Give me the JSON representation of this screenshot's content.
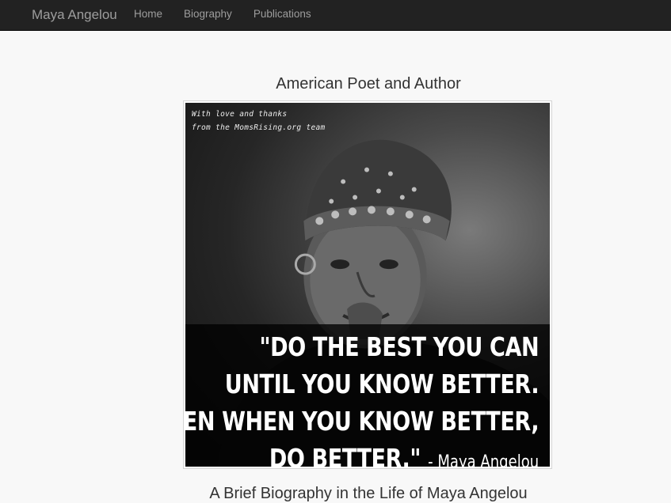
{
  "navbar": {
    "brand": "Maya Angelou",
    "links": [
      {
        "label": "Home"
      },
      {
        "label": "Biography"
      },
      {
        "label": "Publications"
      }
    ]
  },
  "main": {
    "subtitle": "American Poet and Author",
    "photo": {
      "credit_line_1": "With love and thanks",
      "credit_line_2": "from the MomsRising.org team",
      "quote_lines": [
        "\"DO THE BEST YOU CAN",
        "UNTIL YOU KNOW BETTER.",
        "THEN WHEN YOU KNOW BETTER,",
        "DO BETTER.\""
      ],
      "attribution": "- Maya Angelou"
    },
    "heading": "A Brief Biography in the Life of Maya Angelou"
  }
}
